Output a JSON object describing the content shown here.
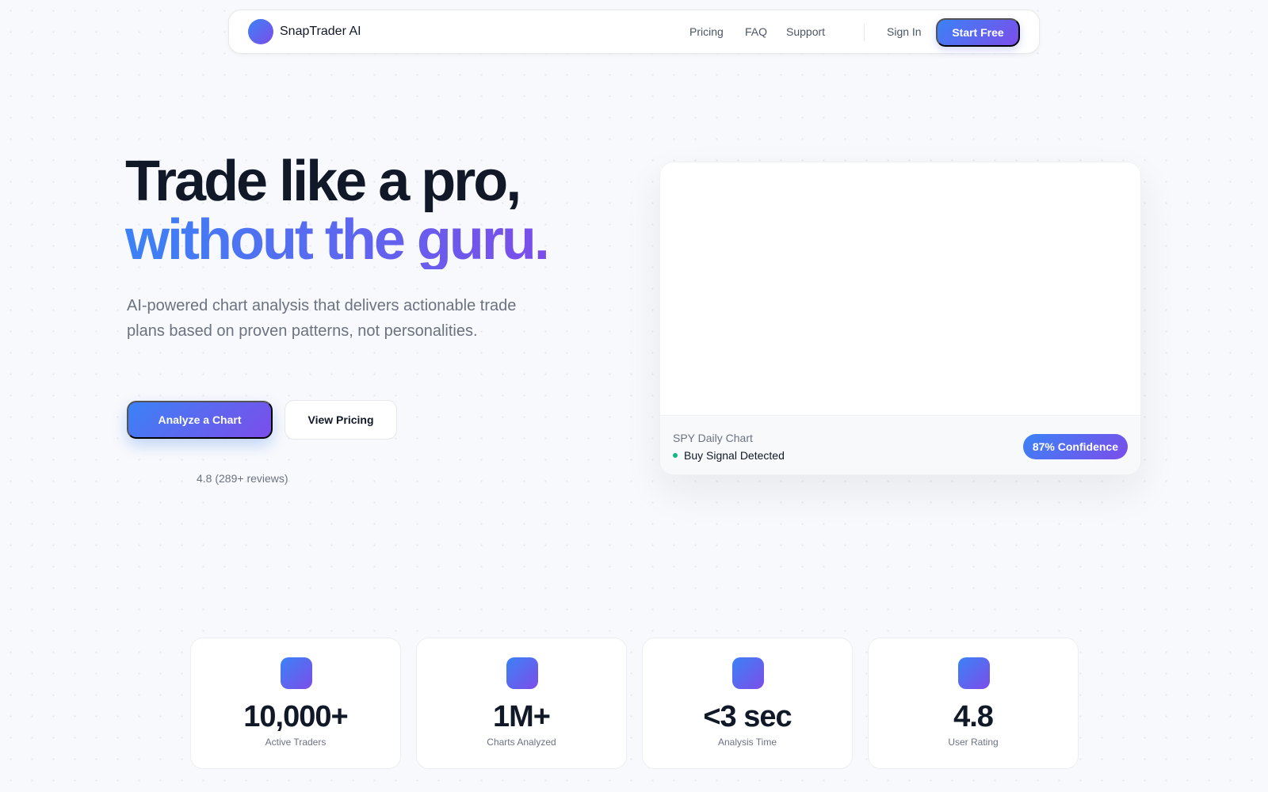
{
  "nav": {
    "brand": "SnapTrader AI",
    "links": [
      "Pricing",
      "FAQ",
      "Support"
    ],
    "sign_in": "Sign In",
    "cta": "Start Free"
  },
  "hero": {
    "title_line1": "Trade like a pro,",
    "title_line2": "without the guru.",
    "subtitle": "AI-powered chart analysis that delivers actionable trade plans based on proven patterns, not personalities.",
    "primary_button": "Analyze a Chart",
    "secondary_button": "View Pricing",
    "rating": "4.8 (289+ reviews)"
  },
  "preview": {
    "caption": "SPY Daily Chart",
    "signal": "Buy Signal Detected",
    "confidence": "87% Confidence"
  },
  "stats": [
    {
      "value": "10,000+",
      "label": "Active Traders"
    },
    {
      "value": "1M+",
      "label": "Charts Analyzed"
    },
    {
      "value": "<3 sec",
      "label": "Analysis Time"
    },
    {
      "value": "4.8",
      "label": "User Rating"
    }
  ],
  "colors": {
    "accent_start": "#3b82f6",
    "accent_end": "#7c4dea",
    "signal_green": "#10b981",
    "text_dark": "#111827",
    "text_muted": "#6b7280"
  }
}
